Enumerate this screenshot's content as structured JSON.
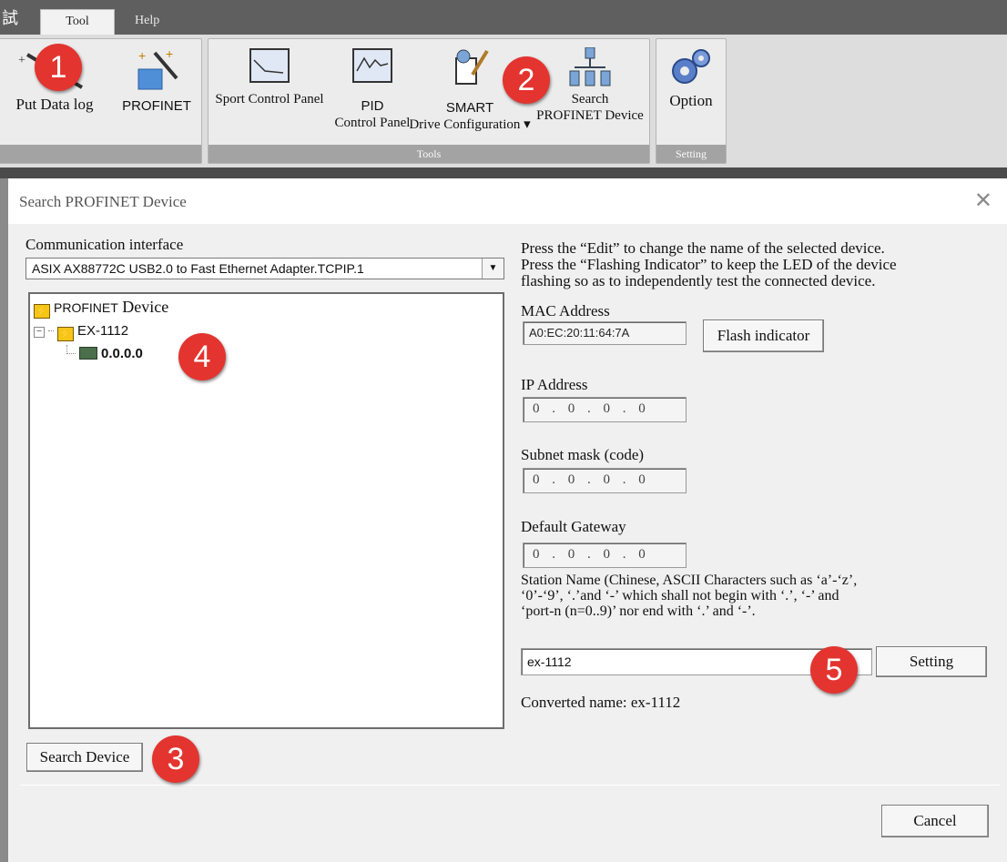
{
  "ribbon": {
    "sys_glyph": "試",
    "tabs": {
      "tool": "Tool",
      "help": "Help"
    },
    "buttons": {
      "put_data_log": "Put Data log",
      "profinet": "PROFINET",
      "sport_control_panel": "Sport Control Panel",
      "pid_top": "PID",
      "pid_bottom": "Control Panel",
      "smart_top": "SMART",
      "smart_bottom": "Drive Configuration ▾",
      "search_top": "Search",
      "search_bottom": "PROFINET Device",
      "option": "Option"
    },
    "groups": {
      "tools": "Tools",
      "setting": "Setting"
    }
  },
  "badges": {
    "b1": "1",
    "b2": "2",
    "b3": "3",
    "b4": "4",
    "b5": "5"
  },
  "dialog": {
    "title": "Search PROFINET Device",
    "close": "✕",
    "comm_label": "Communication interface",
    "comm_value": "ASIX AX88772C USB2.0 to Fast Ethernet Adapter.TCPIP.1",
    "tree": {
      "root_a": "PROFINET",
      "root_b": " Device",
      "device": "EX-1112",
      "ip": "0.0.0.0"
    },
    "instructions": {
      "line1": "Press the “Edit” to change the name of the selected device.",
      "line2": "Press the “Flashing Indicator” to keep the LED of the device",
      "line3": "flashing so as to independently test the connected device."
    },
    "mac_label": "MAC Address",
    "mac_value": "A0:EC:20:11:64:7A",
    "flash_button": "Flash indicator",
    "ip_label": "IP Address",
    "ip_value": "0 . 0 . 0 . 0",
    "subnet_label": "Subnet mask (code)",
    "subnet_value": "0 . 0 . 0 . 0",
    "gateway_label": "Default Gateway",
    "gateway_value": "0 . 0 . 0 . 0",
    "station_label": {
      "line1": "Station Name (Chinese, ASCII Characters such as  ‘a’-‘z’,",
      "line2": "‘0’-‘9’, ‘.’and ‘-’ which shall not begin with ‘.’, ‘-’ and",
      "line3": "‘port-n (n=0..9)’ nor end with ‘.’ and ‘-’."
    },
    "station_value": "ex-1112",
    "setting_button": "Setting",
    "converted_label": "Converted name: ex-1112",
    "search_button": "Search Device",
    "cancel_button": "Cancel"
  }
}
